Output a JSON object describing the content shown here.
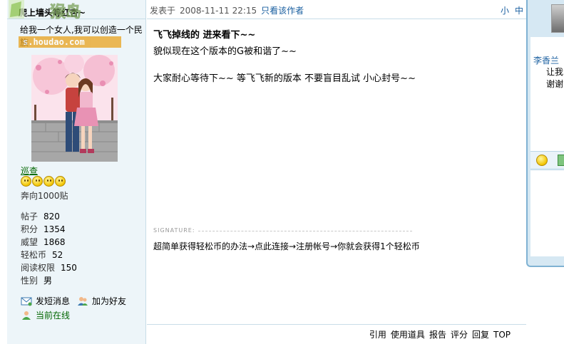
{
  "watermark": {
    "site": "s.houdao.com",
    "logo_text": "猴岛"
  },
  "user": {
    "name": "爬上墙头等红杏~",
    "bio": "给我一个女人,我可以创造一个民族",
    "group": "巡查",
    "rank_title": "奔向1000贴",
    "stars": 4,
    "stats": [
      {
        "label": "帖子",
        "value": "820"
      },
      {
        "label": "积分",
        "value": "1354"
      },
      {
        "label": "威望",
        "value": "1868"
      },
      {
        "label": "轻松币",
        "value": "52"
      },
      {
        "label": "阅读权限",
        "value": "150"
      },
      {
        "label": "性别",
        "value": "男"
      }
    ],
    "actions": {
      "message": "发短消息",
      "add_friend": "加为好友",
      "online": "当前在线"
    }
  },
  "post": {
    "posted_prefix": "发表于",
    "time": "2008-11-11 22:15",
    "author_only": "只看该作者",
    "font_small": "小",
    "font_medium": "中",
    "title": "飞飞掉线的  进来看下~~",
    "lines": [
      "貌似现在这个版本的G被和谐了~~",
      "大家耐心等待下~~       等飞飞新的版本  不要盲目乱试  小心封号~~"
    ],
    "signature_label": "SIGNATURE:",
    "signature": "超简单获得轻松币的办法→点此连接→注册帐号→你就会获得1个轻松币"
  },
  "footer": {
    "quote": "引用",
    "tools": "使用道具",
    "report": "报告",
    "rate": "评分",
    "reply": "回复",
    "top": "TOP"
  },
  "chat": {
    "contact": "李香兰",
    "msg1": "让我",
    "msg2": "谢谢"
  }
}
